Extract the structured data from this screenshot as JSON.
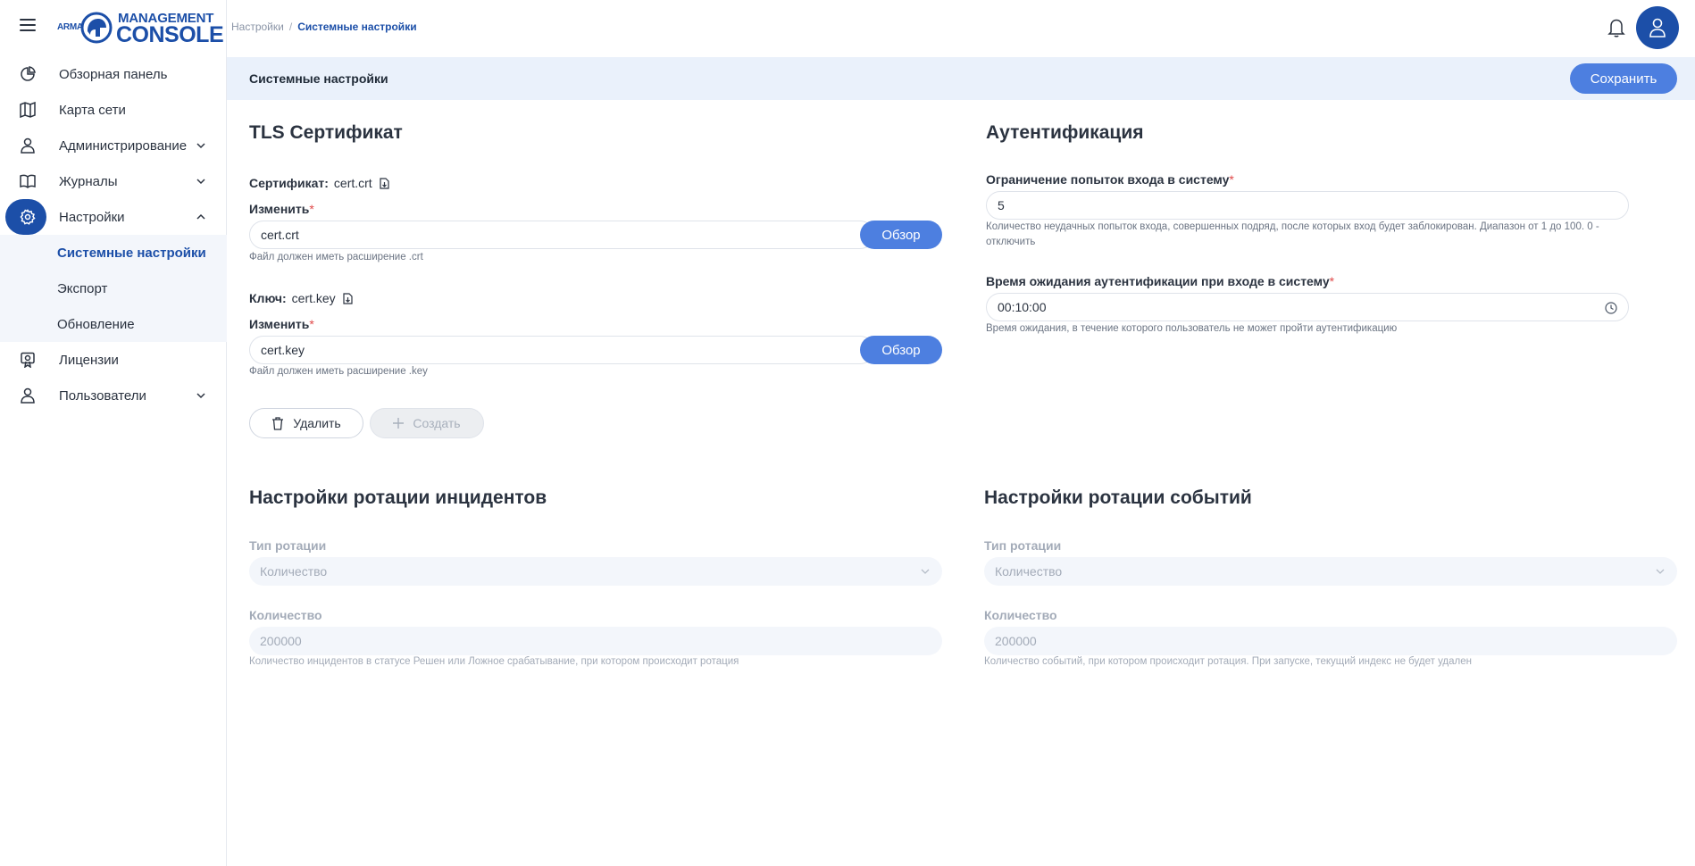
{
  "brand": {
    "arma": "ARMA",
    "management": "MANAGEMENT",
    "console": "CONSOLE"
  },
  "sidebar": {
    "items": [
      {
        "label": "Обзорная панель",
        "icon": "pie-chart-icon"
      },
      {
        "label": "Карта сети",
        "icon": "map-icon"
      },
      {
        "label": "Администрирование",
        "icon": "user-icon"
      },
      {
        "label": "Журналы",
        "icon": "book-icon"
      },
      {
        "label": "Настройки",
        "icon": "gear-icon"
      },
      {
        "label": "Лицензии",
        "icon": "license-icon"
      },
      {
        "label": "Пользователи",
        "icon": "user-icon"
      }
    ],
    "settings_sub": [
      {
        "label": "Системные настройки"
      },
      {
        "label": "Экспорт"
      },
      {
        "label": "Обновление"
      }
    ]
  },
  "breadcrumb": {
    "parent": "Настройки",
    "separator": "/",
    "current": "Системные настройки"
  },
  "page": {
    "title": "Системные настройки",
    "save_label": "Сохранить"
  },
  "tls": {
    "heading": "TLS Сертификат",
    "cert_label": "Сертификат:",
    "cert_value": "cert.crt",
    "change_label": "Изменить",
    "required_mark": "*",
    "cert_input": "cert.crt",
    "browse_label": "Обзор",
    "cert_hint": "Файл должен иметь расширение .crt",
    "key_label": "Ключ:",
    "key_value": "cert.key",
    "key_input": "cert.key",
    "key_hint": "Файл должен иметь расширение .key",
    "delete_label": "Удалить",
    "create_label": "Создать"
  },
  "auth": {
    "heading": "Аутентификация",
    "attempts_label": "Ограничение попыток входа в систему",
    "attempts_value": "5",
    "attempts_hint_line1": "Количество неудачных попыток входа, совершенных подряд, после которых вход будет заблокирован. Диапазон от 1 до 100. 0 -",
    "attempts_hint_line2": "отключить",
    "timeout_label": "Время ожидания аутентификации при входе в систему",
    "timeout_value": "00:10:00",
    "timeout_hint": "Время ожидания, в течение которого пользователь не может пройти аутентификацию"
  },
  "incidents_rotation": {
    "heading": "Настройки ротации инцидентов",
    "type_label": "Тип ротации",
    "type_value": "Количество",
    "count_label": "Количество",
    "count_value": "200000",
    "hint": "Количество инцидентов в статусе Решен или Ложное срабатывание, при котором происходит ротация"
  },
  "events_rotation": {
    "heading": "Настройки ротации событий",
    "type_label": "Тип ротации",
    "type_value": "Количество",
    "count_label": "Количество",
    "count_value": "200000",
    "hint": "Количество событий, при котором происходит ротация. При запуске, текущий индекс не будет удален"
  },
  "colors": {
    "brand": "#1c4fa8",
    "accent": "#4d7fe0",
    "required": "#e04848",
    "page_bar": "#eaf1fb"
  }
}
